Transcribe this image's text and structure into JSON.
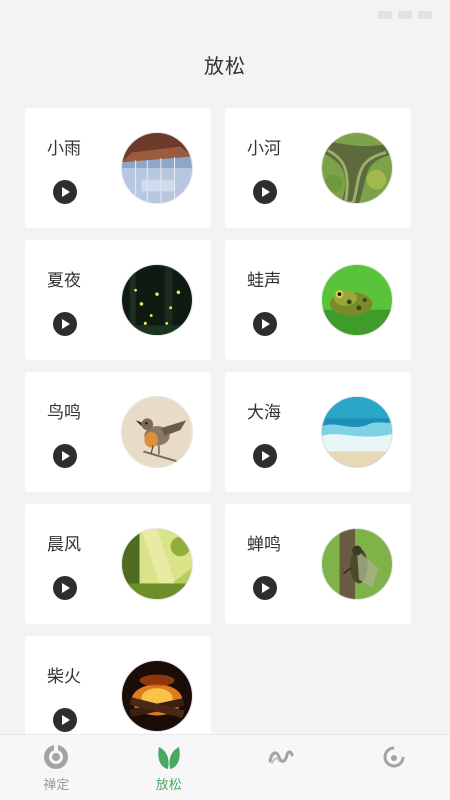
{
  "header": {
    "title": "放松"
  },
  "sounds": [
    {
      "label": "小雨",
      "image": "rain-under-umbrella-image"
    },
    {
      "label": "小河",
      "image": "river-image"
    },
    {
      "label": "夏夜",
      "image": "summer-night-fireflies-image"
    },
    {
      "label": "蛙声",
      "image": "frog-image"
    },
    {
      "label": "鸟鸣",
      "image": "bird-image"
    },
    {
      "label": "大海",
      "image": "sea-waves-image"
    },
    {
      "label": "晨风",
      "image": "morning-forest-image"
    },
    {
      "label": "蝉鸣",
      "image": "cicada-image"
    },
    {
      "label": "柴火",
      "image": "campfire-image"
    }
  ],
  "tabbar": {
    "items": [
      {
        "label": "禅定",
        "icon": "meditation-icon",
        "active": false
      },
      {
        "label": "放松",
        "icon": "leaf-icon",
        "active": true
      },
      {
        "label": "",
        "icon": "wave-icon",
        "active": false
      },
      {
        "label": "",
        "icon": "profile-icon",
        "active": false
      }
    ]
  },
  "colors": {
    "accent": "#4aa864",
    "background": "#f3f3f3",
    "card": "#ffffff"
  }
}
